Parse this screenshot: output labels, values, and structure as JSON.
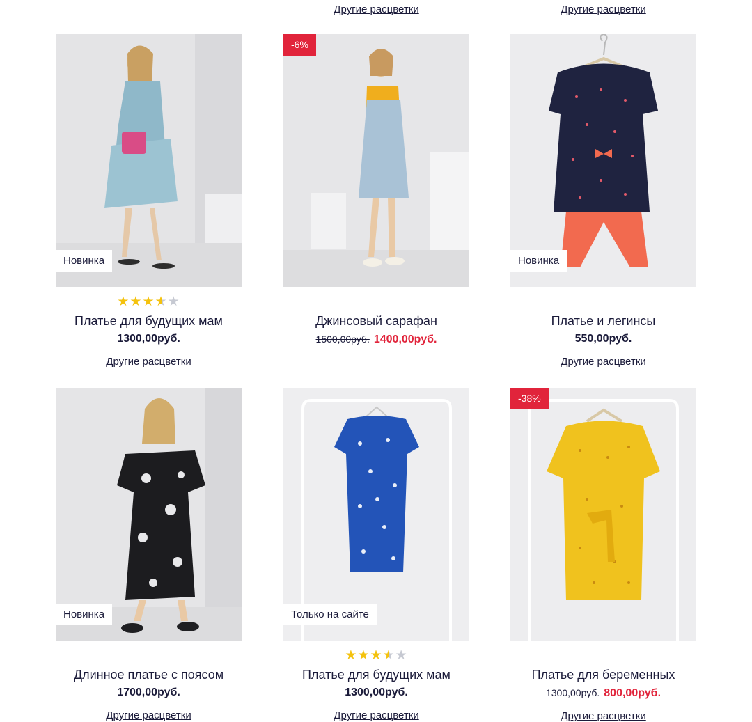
{
  "top_links": [
    "Другие расцветки",
    "Другие расцветки"
  ],
  "products": [
    {
      "name": "Платье для будущих мам",
      "price": "1300,00руб.",
      "badge": "Новинка",
      "rating": 3.5,
      "other_colors": "Другие расцветки"
    },
    {
      "name": "Джинсовый сарафан",
      "old_price": "1500,00руб.",
      "price": "1400,00руб.",
      "discount": "-6%",
      "other_colors": ""
    },
    {
      "name": "Платье и легинсы",
      "price": "550,00руб.",
      "badge": "Новинка",
      "other_colors": "Другие расцветки"
    },
    {
      "name": "Длинное платье с поясом",
      "price": "1700,00руб.",
      "badge": "Новинка",
      "other_colors": "Другие расцветки"
    },
    {
      "name": "Платье для будущих мам",
      "price": "1300,00руб.",
      "badge": "Только на сайте",
      "rating": 3.5,
      "other_colors": "Другие расцветки"
    },
    {
      "name": "Платье для беременных",
      "old_price": "1300,00руб.",
      "price": "800,00руб.",
      "discount": "-38%",
      "other_colors": "Другие расцветки"
    }
  ],
  "colors": {
    "accent_red": "#e1243b",
    "star": "#f4c20d",
    "text": "#1b1b3a"
  }
}
